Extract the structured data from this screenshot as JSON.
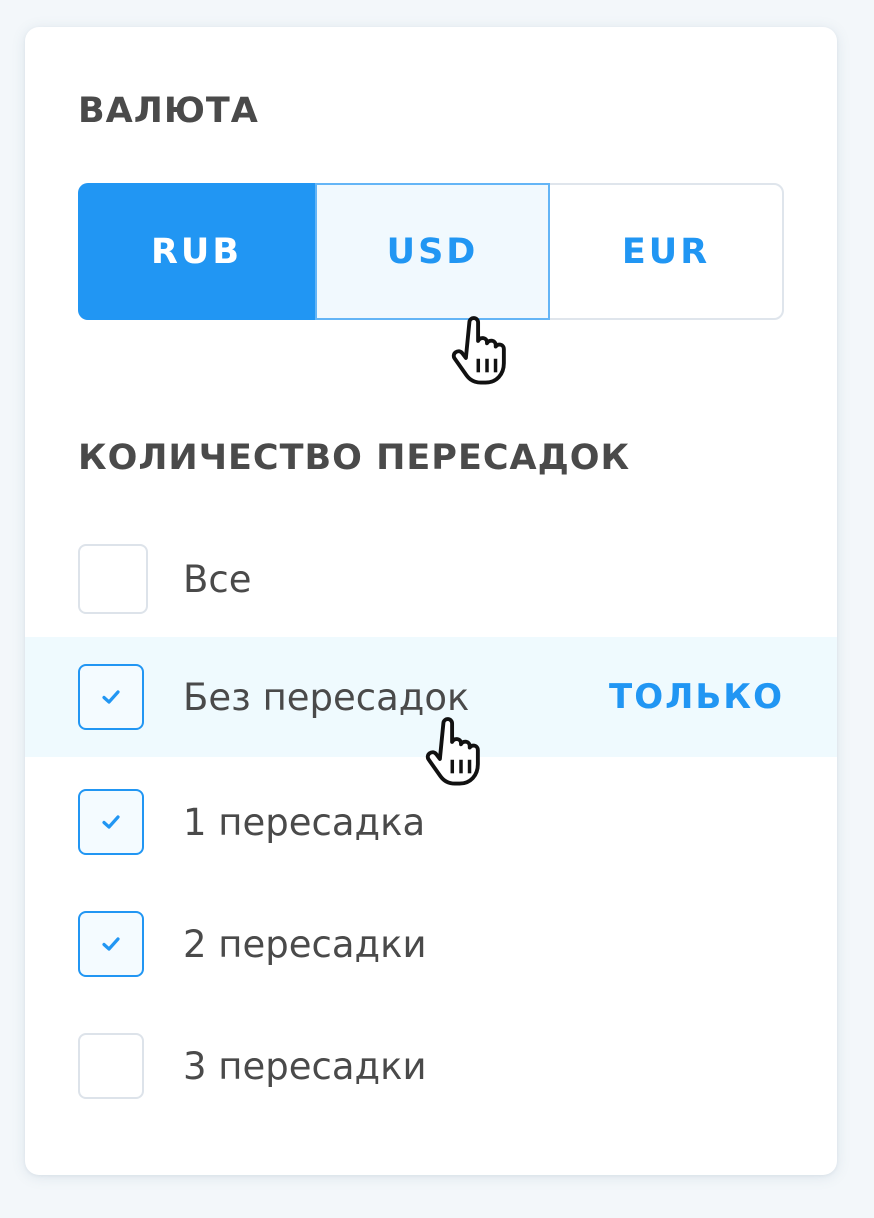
{
  "currency": {
    "title": "ВАЛЮТА",
    "options": [
      {
        "label": "RUB",
        "state": "selected"
      },
      {
        "label": "USD",
        "state": "hover"
      },
      {
        "label": "EUR",
        "state": "default"
      }
    ]
  },
  "stops": {
    "title": "КОЛИЧЕСТВО ПЕРЕСАДОК",
    "options": [
      {
        "label": "Все",
        "checked": false
      },
      {
        "label": "Без пересадок",
        "checked": true,
        "hovered": true,
        "only_label": "ТОЛЬКО"
      },
      {
        "label": "1 пересадка",
        "checked": true
      },
      {
        "label": "2 пересадки",
        "checked": true
      },
      {
        "label": "3 пересадки",
        "checked": false
      }
    ]
  },
  "colors": {
    "accent": "#2196f3",
    "hover_row": "#effafe",
    "text": "#4a4a4a",
    "border": "#dfe5ec",
    "page_bg": "#f3f7fa"
  },
  "icons": {
    "cursor": "hand-pointer-icon",
    "checkmark": "checkmark-icon"
  }
}
